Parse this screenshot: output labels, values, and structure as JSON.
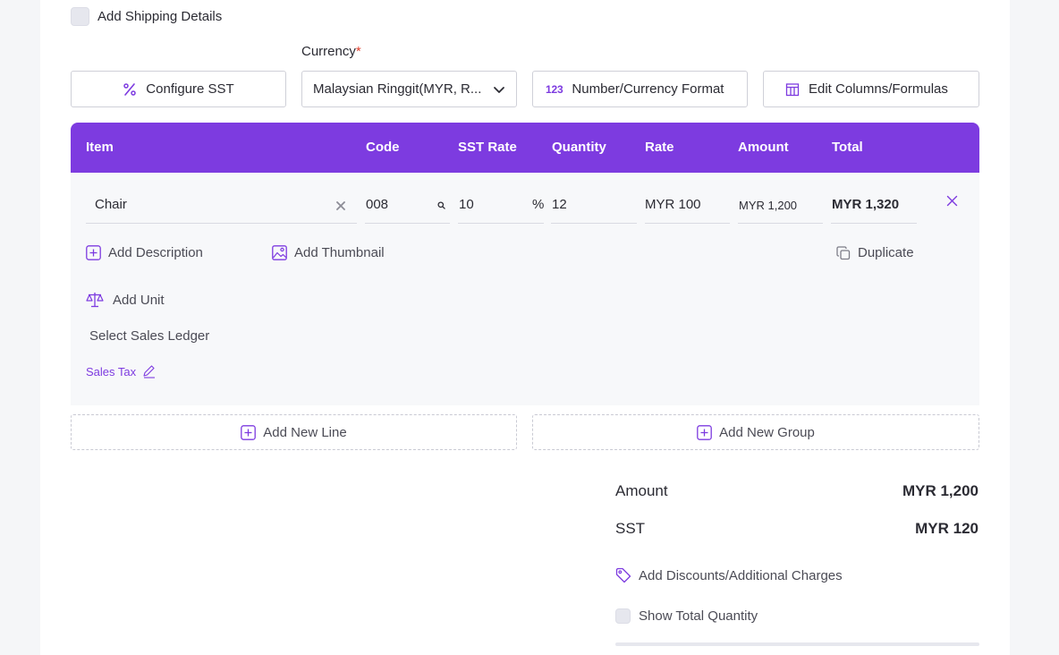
{
  "shipping": {
    "label": "Add Shipping Details"
  },
  "currency": {
    "label": "Currency",
    "required_mark": "*",
    "selected": "Malaysian Ringgit(MYR, R..."
  },
  "toolbar": {
    "configure_sst": "Configure SST",
    "number_format_icon": "123",
    "number_format": "Number/Currency Format",
    "edit_columns": "Edit Columns/Formulas"
  },
  "table": {
    "headers": {
      "item": "Item",
      "code": "Code",
      "sst_rate": "SST Rate",
      "quantity": "Quantity",
      "rate": "Rate",
      "amount": "Amount",
      "total": "Total"
    },
    "row": {
      "item": "Chair",
      "code": "008",
      "sst_rate": "10",
      "sst_unit": "%",
      "quantity": "12",
      "rate": "MYR 100",
      "amount": "MYR 1,200",
      "total": "MYR 1,320"
    }
  },
  "row_actions": {
    "add_description": "Add Description",
    "add_thumbnail": "Add Thumbnail",
    "duplicate": "Duplicate",
    "add_unit": "Add Unit",
    "select_ledger": "Select Sales Ledger",
    "sales_tax": "Sales Tax"
  },
  "add_line": "Add New Line",
  "add_group": "Add New Group",
  "summary": {
    "amount_label": "Amount",
    "amount_value": "MYR 1,200",
    "sst_label": "SST",
    "sst_value": "MYR 120",
    "discounts": "Add Discounts/Additional Charges",
    "show_total_qty": "Show Total Quantity"
  },
  "colors": {
    "accent": "#7d3be0",
    "text": "#2b2b33"
  }
}
